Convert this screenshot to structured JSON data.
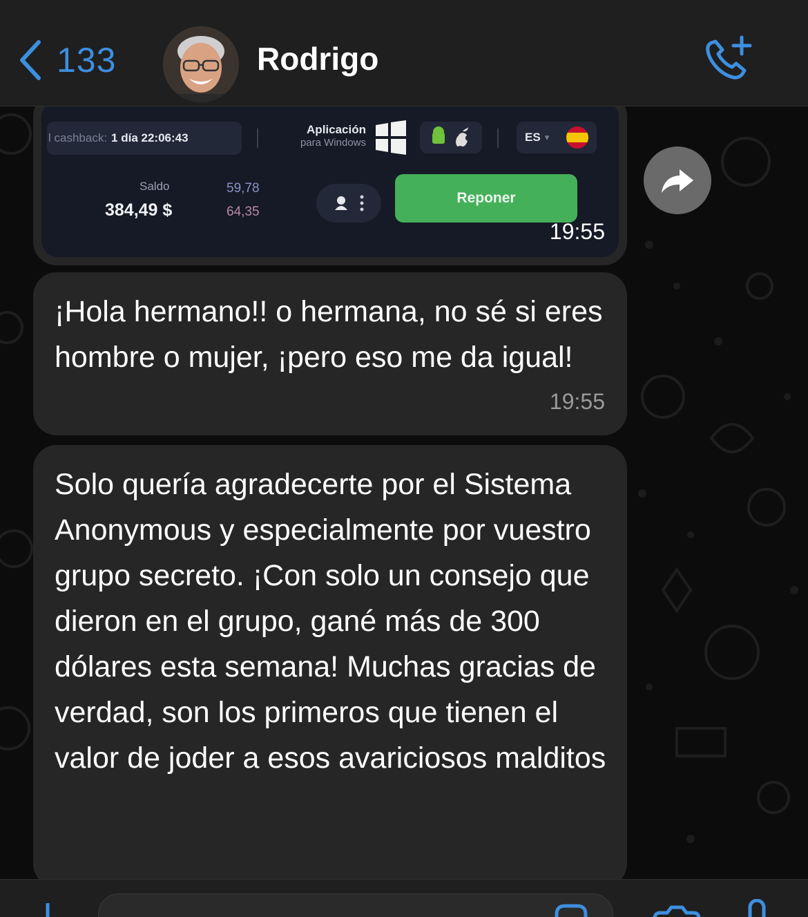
{
  "header": {
    "back_count": "133",
    "contact_name": "Rodrigo",
    "icons": {
      "back": "chevron-left-icon",
      "call": "phone-add-icon"
    }
  },
  "image_message": {
    "time": "19:55",
    "screenshot": {
      "cashback_label": "l cashback:",
      "cashback_value": "1 día 22:06:43",
      "app_line1": "Aplicación",
      "app_line2": "para Windows",
      "language": "ES",
      "saldo_label": "Saldo",
      "saldo_value": "384,49 $",
      "sub_value_1": "59,78",
      "sub_value_2": "64,35",
      "button": "Reponer"
    }
  },
  "messages": [
    {
      "text": "¡Hola hermano!! o hermana, no sé si eres hombre o mujer, ¡pero eso me da igual!",
      "time": "19:55"
    },
    {
      "text": "Solo quería agradecerte por el Sistema Anonymous y especialmente por vuestro grupo secreto. ¡Con solo un consejo que dieron en el grupo, gané más de 300 dólares esta semana! Muchas gracias de verdad, son los primeros que tienen el valor de joder a esos avariciosos malditos",
      "time": ""
    }
  ],
  "composer": {
    "input_value": "",
    "icons": [
      "plus-icon",
      "sticker-icon",
      "camera-icon",
      "microphone-icon"
    ]
  },
  "colors": {
    "accent": "#3d8fe0",
    "bubble": "#262626",
    "header": "#1f1f1f",
    "button_green": "#45b05a"
  }
}
